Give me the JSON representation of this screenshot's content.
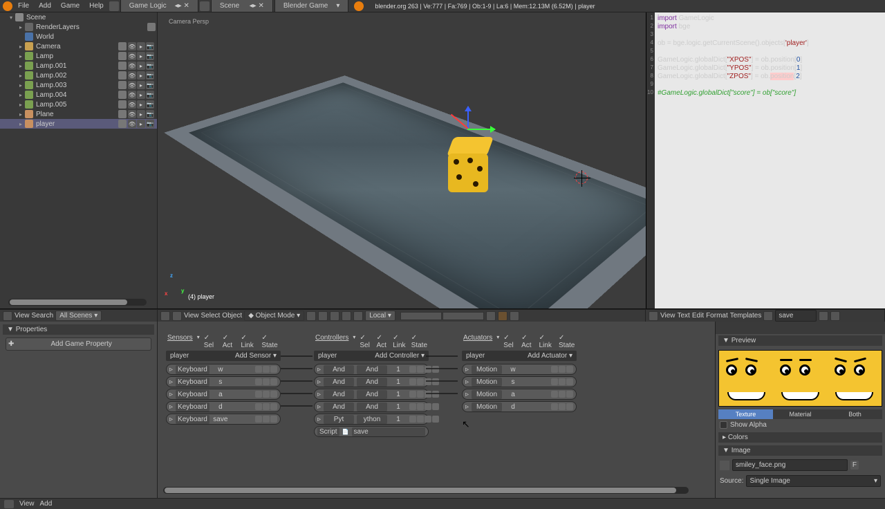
{
  "menubar": {
    "file": "File",
    "add": "Add",
    "game": "Game",
    "help": "Help",
    "screen_layout": "Game Logic",
    "scene_dd": "Scene",
    "engine": "Blender Game",
    "stats": "blender.org 263 | Ve:777 | Fa:769 | Ob:1-9 | La:6 | Mem:12.13M (6.52M) | player"
  },
  "outliner": {
    "items": [
      {
        "name": "Scene",
        "icon": "ic-scene",
        "indent": 0,
        "tri": "▾"
      },
      {
        "name": "RenderLayers",
        "icon": "ic-layers",
        "indent": 1,
        "tri": "▸",
        "extra": true
      },
      {
        "name": "World",
        "icon": "ic-world",
        "indent": 1,
        "tri": ""
      },
      {
        "name": "Camera",
        "icon": "ic-cam",
        "indent": 1,
        "tri": "▸",
        "btns": true,
        "extra": true
      },
      {
        "name": "Lamp",
        "icon": "ic-lamp",
        "indent": 1,
        "tri": "▸",
        "btns": true,
        "extra": true
      },
      {
        "name": "Lamp.001",
        "icon": "ic-lamp",
        "indent": 1,
        "tri": "▸",
        "btns": true,
        "extra": true
      },
      {
        "name": "Lamp.002",
        "icon": "ic-lamp",
        "indent": 1,
        "tri": "▸",
        "btns": true,
        "extra": true
      },
      {
        "name": "Lamp.003",
        "icon": "ic-lamp",
        "indent": 1,
        "tri": "▸",
        "btns": true,
        "extra": true
      },
      {
        "name": "Lamp.004",
        "icon": "ic-lamp",
        "indent": 1,
        "tri": "▸",
        "btns": true,
        "extra": true
      },
      {
        "name": "Lamp.005",
        "icon": "ic-lamp",
        "indent": 1,
        "tri": "▸",
        "btns": true,
        "extra": true
      },
      {
        "name": "Plane",
        "icon": "ic-mesh",
        "indent": 1,
        "tri": "▸",
        "btns": true,
        "extra": true
      },
      {
        "name": "player",
        "icon": "ic-player",
        "indent": 1,
        "tri": "▸",
        "btns": true,
        "sel": true,
        "extra": true
      }
    ]
  },
  "viewport": {
    "label": "Camera Persp",
    "obj": "(4) player"
  },
  "vp_header": {
    "view": "View",
    "select": "Select",
    "object": "Object",
    "mode": "Object Mode",
    "local": "Local"
  },
  "text_editor": {
    "lines": [
      {
        "n": 1,
        "html": "<span class='kw'>import</span> GameLogic"
      },
      {
        "n": 2,
        "html": "<span class='kw'>import</span> bge"
      },
      {
        "n": 3,
        "html": ""
      },
      {
        "n": 4,
        "html": "ob = bge.logic.getCurrentScene().objects[<span class='s1'>'player'</span>]"
      },
      {
        "n": 5,
        "html": ""
      },
      {
        "n": 6,
        "html": "GameLogic.globalDict[<span class='s1'>\"XPOS\"</span>] = ob.position[<span class='s2'>0</span>]"
      },
      {
        "n": 7,
        "html": "GameLogic.globalDict[<span class='s1'>\"YPOS\"</span>] = ob.position[<span class='s2'>1</span>]"
      },
      {
        "n": 8,
        "html": "GameLogic.globalDict[<span class='s1'>\"ZPOS\"</span>] = ob.<span class='hl'>position</span>[<span class='s2'>2</span>]"
      },
      {
        "n": 9,
        "html": ""
      },
      {
        "n": 10,
        "html": "<span class='cm'>#GameLogic.globalDict[\"score\"] = ob[\"score\"]</span>"
      }
    ],
    "filename": "save"
  },
  "te_header": {
    "view": "View",
    "text": "Text",
    "edit": "Edit",
    "format": "Format",
    "templates": "Templates"
  },
  "props": {
    "hdr": "Properties",
    "add": "Add Game Property"
  },
  "logic": {
    "sensors": {
      "title": "Sensors",
      "sub_obj": "player",
      "sub_add": "Add Sensor",
      "rows": [
        {
          "type": "Keyboard",
          "val": "w"
        },
        {
          "type": "Keyboard",
          "val": "s"
        },
        {
          "type": "Keyboard",
          "val": "a"
        },
        {
          "type": "Keyboard",
          "val": "d"
        },
        {
          "type": "Keyboard",
          "val": "save"
        }
      ]
    },
    "controllers": {
      "title": "Controllers",
      "sub_obj": "player",
      "sub_add": "Add Controller",
      "rows": [
        {
          "type": "And",
          "n": "And",
          "v": "1"
        },
        {
          "type": "And",
          "n": "And",
          "v": "1"
        },
        {
          "type": "And",
          "n": "And",
          "v": "1"
        },
        {
          "type": "And",
          "n": "And",
          "v": "1"
        },
        {
          "type": "Pyt",
          "n": "ython",
          "v": "1"
        }
      ],
      "script_label": "Script",
      "script_val": "save"
    },
    "actuators": {
      "title": "Actuators",
      "sub_obj": "player",
      "sub_add": "Add Actuator",
      "rows": [
        {
          "type": "Motion",
          "val": "w"
        },
        {
          "type": "Motion",
          "val": "s"
        },
        {
          "type": "Motion",
          "val": "a"
        },
        {
          "type": "Motion",
          "val": "d"
        }
      ]
    },
    "hdr_flags": [
      "Sel",
      "Act",
      "Link",
      "State"
    ]
  },
  "ol_header": {
    "view": "View",
    "search": "Search",
    "dd": "All Scenes"
  },
  "img": {
    "preview": "Preview",
    "tab1": "Texture",
    "tab2": "Material",
    "tab3": "Both",
    "showalpha": "Show Alpha",
    "colors": "Colors",
    "image": "Image",
    "file": "smiley_face.png",
    "source": "Source:",
    "source_val": "Single Image"
  },
  "bottom": {
    "view": "View",
    "add": "Add"
  }
}
